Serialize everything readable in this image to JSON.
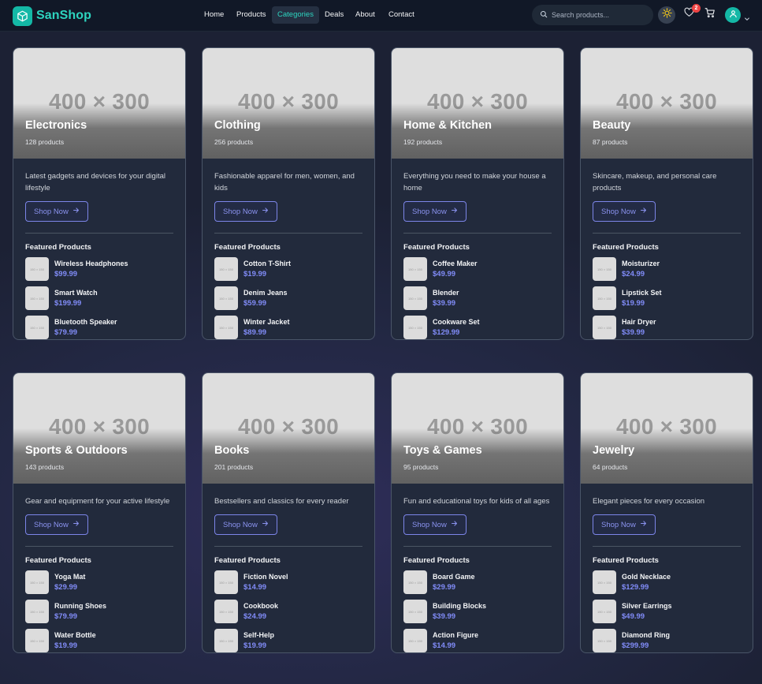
{
  "brand": {
    "name": "SanShop"
  },
  "nav": [
    "Home",
    "Products",
    "Categories",
    "Deals",
    "About",
    "Contact"
  ],
  "nav_active": "Categories",
  "search": {
    "placeholder": "Search products..."
  },
  "wishlist_count": "2",
  "featured_label": "Featured Products",
  "shop_now_label": "Shop Now",
  "image_placeholder": "400 × 300",
  "thumb_placeholder": "150 × 150",
  "colors": {
    "accent": "#2dd4bf",
    "link": "#818cf8",
    "badge": "#ef4444"
  },
  "categories": [
    {
      "title": "Electronics",
      "count": "128 products",
      "description": "Latest gadgets and devices for your digital lifestyle",
      "products": [
        {
          "name": "Wireless Headphones",
          "price": "$99.99"
        },
        {
          "name": "Smart Watch",
          "price": "$199.99"
        },
        {
          "name": "Bluetooth Speaker",
          "price": "$79.99"
        }
      ]
    },
    {
      "title": "Clothing",
      "count": "256 products",
      "description": "Fashionable apparel for men, women, and kids",
      "products": [
        {
          "name": "Cotton T-Shirt",
          "price": "$19.99"
        },
        {
          "name": "Denim Jeans",
          "price": "$59.99"
        },
        {
          "name": "Winter Jacket",
          "price": "$89.99"
        }
      ]
    },
    {
      "title": "Home & Kitchen",
      "count": "192 products",
      "description": "Everything you need to make your house a home",
      "products": [
        {
          "name": "Coffee Maker",
          "price": "$49.99"
        },
        {
          "name": "Blender",
          "price": "$39.99"
        },
        {
          "name": "Cookware Set",
          "price": "$129.99"
        }
      ]
    },
    {
      "title": "Beauty",
      "count": "87 products",
      "description": "Skincare, makeup, and personal care products",
      "products": [
        {
          "name": "Moisturizer",
          "price": "$24.99"
        },
        {
          "name": "Lipstick Set",
          "price": "$19.99"
        },
        {
          "name": "Hair Dryer",
          "price": "$39.99"
        }
      ]
    },
    {
      "title": "Sports & Outdoors",
      "count": "143 products",
      "description": "Gear and equipment for your active lifestyle",
      "products": [
        {
          "name": "Yoga Mat",
          "price": "$29.99"
        },
        {
          "name": "Running Shoes",
          "price": "$79.99"
        },
        {
          "name": "Water Bottle",
          "price": "$19.99"
        }
      ]
    },
    {
      "title": "Books",
      "count": "201 products",
      "description": "Bestsellers and classics for every reader",
      "products": [
        {
          "name": "Fiction Novel",
          "price": "$14.99"
        },
        {
          "name": "Cookbook",
          "price": "$24.99"
        },
        {
          "name": "Self-Help",
          "price": "$19.99"
        }
      ]
    },
    {
      "title": "Toys & Games",
      "count": "95 products",
      "description": "Fun and educational toys for kids of all ages",
      "products": [
        {
          "name": "Board Game",
          "price": "$29.99"
        },
        {
          "name": "Building Blocks",
          "price": "$39.99"
        },
        {
          "name": "Action Figure",
          "price": "$14.99"
        }
      ]
    },
    {
      "title": "Jewelry",
      "count": "64 products",
      "description": "Elegant pieces for every occasion",
      "products": [
        {
          "name": "Gold Necklace",
          "price": "$129.99"
        },
        {
          "name": "Silver Earrings",
          "price": "$49.99"
        },
        {
          "name": "Diamond Ring",
          "price": "$299.99"
        }
      ]
    }
  ]
}
